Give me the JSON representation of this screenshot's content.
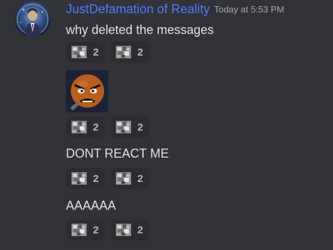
{
  "message": {
    "username": "JustDefamation of Reality",
    "timestamp": "Today at 5:53 PM",
    "lines": [
      "why deleted the messages",
      "DONT REACT ME",
      "AAAAAA"
    ]
  },
  "reaction_groups": [
    [
      {
        "emoji": "pixel-cat-emoji",
        "count": "2"
      },
      {
        "emoji": "pixel-cat-emoji",
        "count": "2"
      }
    ],
    [
      {
        "emoji": "pixel-cat-emoji",
        "count": "2"
      },
      {
        "emoji": "pixel-cat-emoji",
        "count": "2"
      }
    ],
    [
      {
        "emoji": "pixel-cat-emoji",
        "count": "2"
      },
      {
        "emoji": "pixel-cat-emoji",
        "count": "2"
      }
    ],
    [
      {
        "emoji": "pixel-cat-emoji",
        "count": "2"
      },
      {
        "emoji": "pixel-cat-emoji",
        "count": "2"
      }
    ]
  ],
  "sticker": {
    "icon": "angry-face-sticker"
  },
  "colors": {
    "background": "#323338",
    "username": "#4d7dff",
    "text": "#dfe1e5",
    "timestamp": "#a6a8ad",
    "reaction_bg": "#2b2d31"
  }
}
